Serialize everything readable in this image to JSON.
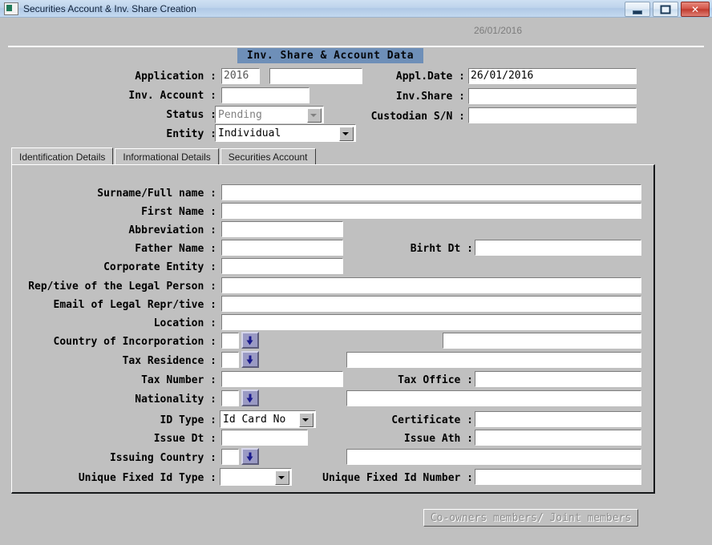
{
  "window": {
    "title": "Securities Account & Inv. Share Creation",
    "icon": "app-icon",
    "minimize_label": "",
    "maximize_label": "",
    "close_label": "✕"
  },
  "header": {
    "date": "26/01/2016",
    "band_title": "Inv. Share & Account Data"
  },
  "top_form": {
    "left": [
      {
        "label": "Application :",
        "value": "2016",
        "value2": ""
      },
      {
        "label": "Inv. Account :",
        "value": ""
      },
      {
        "label": "Status :",
        "value": "Pending",
        "disabled": true
      },
      {
        "label": "Entity :",
        "value": "Individual",
        "disabled": false
      }
    ],
    "right": [
      {
        "label": "Appl.Date :",
        "value": "26/01/2016"
      },
      {
        "label": "Inv.Share :",
        "value": ""
      },
      {
        "label": "Custodian S/N :",
        "value": ""
      }
    ]
  },
  "tabs": [
    {
      "label": "Identification Details",
      "active": true
    },
    {
      "label": "Informational Details",
      "active": false
    },
    {
      "label": "Securities Account",
      "active": false
    }
  ],
  "identification": {
    "labels": {
      "surname": "Surname/Full name :",
      "first_name": "First Name :",
      "abbreviation": "Abbreviation :",
      "father_name": "Father Name :",
      "corporate_entity": "Corporate Entity :",
      "rep_legal_person": "Rep/tive of the Legal Person :",
      "email_legal_rep": "Email of Legal Repr/tive :",
      "location": "Location :",
      "country_incorporation": "Country of Incorporation :",
      "tax_residence": "Tax Residence :",
      "tax_number": "Tax Number :",
      "nationality": "Nationality :",
      "id_type": "ID Type :",
      "issue_dt": "Issue Dt :",
      "issuing_country": "Issuing Country :",
      "unique_fixed_id_type": "Unique Fixed Id Type :",
      "birth_dt": "Birht Dt :",
      "tax_office": "Tax Office :",
      "certificate": "Certificate :",
      "issue_ath": "Issue Ath :",
      "unique_fixed_id_number": "Unique Fixed Id Number :"
    },
    "values": {
      "surname": "",
      "first_name": "",
      "abbreviation": "",
      "father_name": "",
      "corporate_entity": "",
      "rep_legal_person": "",
      "email_legal_rep": "",
      "location": "",
      "country_incorporation_code": "",
      "country_incorporation_name": "",
      "tax_residence_code": "",
      "tax_residence_name": "",
      "tax_number": "",
      "nationality_code": "",
      "nationality_name": "",
      "id_type": "Id Card No",
      "issue_dt": "",
      "issuing_country_code": "",
      "issuing_country_name": "",
      "unique_fixed_id_type": "",
      "birth_dt": "",
      "tax_office": "",
      "certificate": "",
      "issue_ath": "",
      "unique_fixed_id_number": ""
    }
  },
  "footer": {
    "coowners_button": "Co-owners members/ Joint members"
  },
  "colors": {
    "window_face": "#c0c0c0",
    "band_blue": "#6e8fb8",
    "titlebar_blue": "#bed4ec",
    "lookup_button": "#9a9ac4",
    "lookup_arrow": "#1a1a8c",
    "close_red": "#c4402f",
    "disabled_text": "#8e8e8e"
  }
}
